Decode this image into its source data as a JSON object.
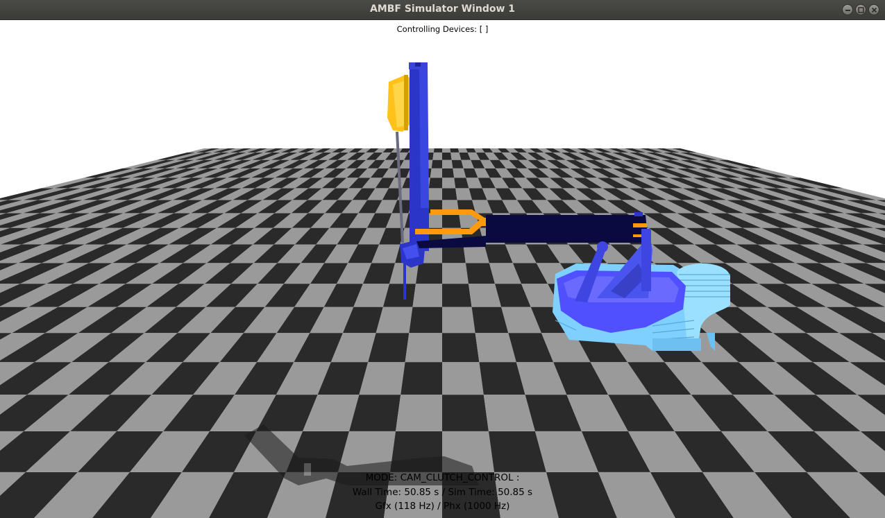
{
  "window": {
    "title": "AMBF Simulator Window 1",
    "controls": [
      {
        "name": "minimize",
        "icon": "minimize-icon"
      },
      {
        "name": "maximize",
        "icon": "maximize-icon"
      },
      {
        "name": "close",
        "icon": "close-icon"
      }
    ]
  },
  "viewport": {
    "controlling_devices": "Controlling Devices: [ ]",
    "mode": "MODE: CAM_CLUTCH_CONTROL :",
    "time": "Wall Time: 50.85 s / Sim Time: 50.85 s",
    "rates": "Gfx (118 Hz) / Phx (1000 Hz)"
  },
  "colors": {
    "floor_dark": "#2a2a2a",
    "floor_light": "#9a9a9a",
    "arm_blue": "#2b35c8",
    "gripper_orange": "#ff9a0d",
    "tool_yellow": "#ffc21a",
    "base_blue": "#5050ff",
    "base_cyan": "#7fd0ff",
    "link_dark": "#0a0a40"
  }
}
